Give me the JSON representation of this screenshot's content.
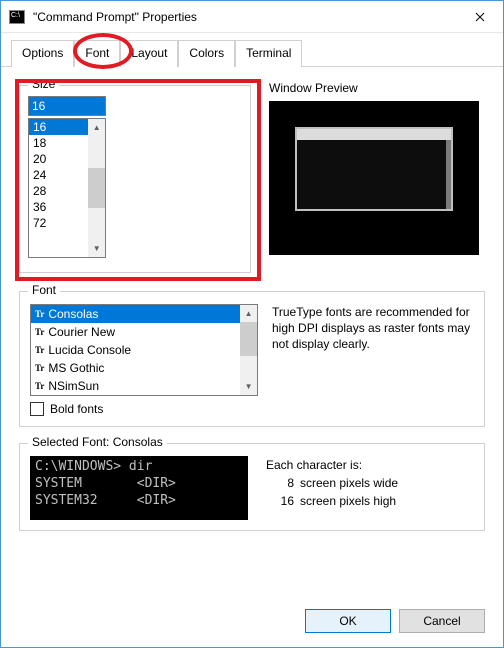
{
  "title": "\"Command Prompt\" Properties",
  "tabs": [
    "Options",
    "Font",
    "Layout",
    "Colors",
    "Terminal"
  ],
  "active_tab": "Font",
  "size": {
    "label": "Size",
    "value": "16",
    "options": [
      "16",
      "18",
      "20",
      "24",
      "28",
      "36",
      "72"
    ]
  },
  "preview": {
    "label": "Window Preview"
  },
  "font": {
    "label": "Font",
    "items": [
      "Consolas",
      "Courier New",
      "Lucida Console",
      "MS Gothic",
      "NSimSun"
    ],
    "selected": "Consolas",
    "description": "TrueType fonts are recommended for high DPI displays as raster fonts may not display clearly.",
    "bold_label": "Bold fonts"
  },
  "selected_font": {
    "label": "Selected Font: Consolas",
    "sample_lines": [
      "C:\\WINDOWS> dir",
      "SYSTEM       <DIR>",
      "SYSTEM32     <DIR>"
    ],
    "info_header": "Each character is:",
    "width_value": "8",
    "width_label": "screen pixels wide",
    "height_value": "16",
    "height_label": "screen pixels high"
  },
  "buttons": {
    "ok": "OK",
    "cancel": "Cancel"
  }
}
